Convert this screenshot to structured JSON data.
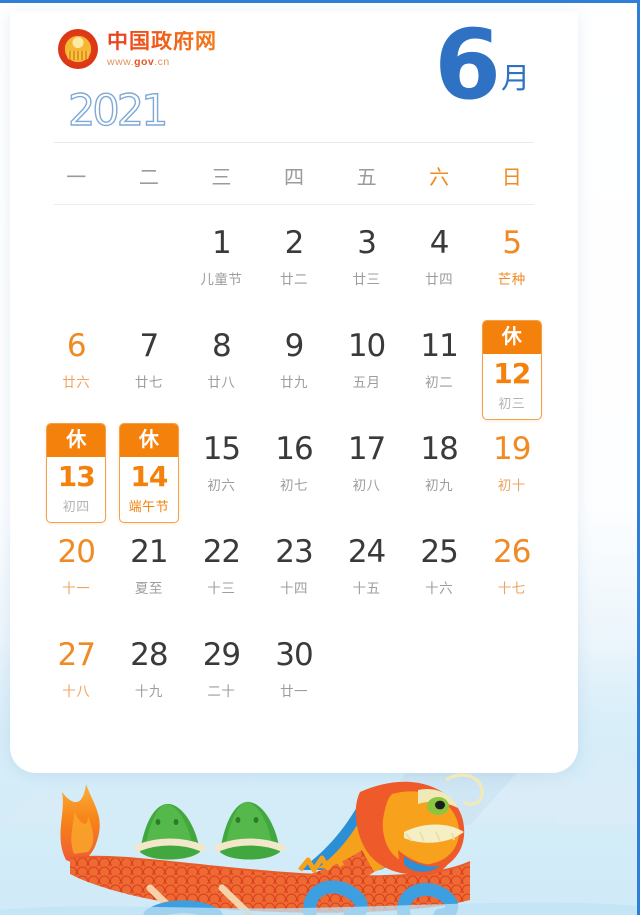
{
  "brand": {
    "name": "中国政府网",
    "url_prefix": "www.",
    "url_main": "gov",
    "url_suffix": ".cn",
    "emblem_icon": "national-emblem-icon"
  },
  "header": {
    "year": "2021",
    "month_number": "6",
    "month_unit": "月"
  },
  "colors": {
    "accent_blue": "#2f72c4",
    "accent_orange": "#f4810c",
    "weekend_orange": "#f08a24",
    "weekday_gray": "#9b9b9b",
    "border_blue": "#2f7ed8"
  },
  "weekdays": [
    {
      "label": "一",
      "weekend": false
    },
    {
      "label": "二",
      "weekend": false
    },
    {
      "label": "三",
      "weekend": false
    },
    {
      "label": "四",
      "weekend": false
    },
    {
      "label": "五",
      "weekend": false
    },
    {
      "label": "六",
      "weekend": true
    },
    {
      "label": "日",
      "weekend": true
    }
  ],
  "rest_label": "休",
  "days": [
    {
      "blank": true
    },
    {
      "blank": true
    },
    {
      "num": "1",
      "sub": "儿童节",
      "type": "normal"
    },
    {
      "num": "2",
      "sub": "廿二",
      "type": "normal"
    },
    {
      "num": "3",
      "sub": "廿三",
      "type": "normal"
    },
    {
      "num": "4",
      "sub": "廿四",
      "type": "normal"
    },
    {
      "num": "5",
      "sub": "芒种",
      "type": "term"
    },
    {
      "num": "6",
      "sub": "廿六",
      "type": "weekend"
    },
    {
      "num": "7",
      "sub": "廿七",
      "type": "normal"
    },
    {
      "num": "8",
      "sub": "廿八",
      "type": "normal"
    },
    {
      "num": "9",
      "sub": "廿九",
      "type": "normal"
    },
    {
      "num": "10",
      "sub": "五月",
      "type": "normal"
    },
    {
      "num": "11",
      "sub": "初二",
      "type": "normal"
    },
    {
      "num": "12",
      "sub": "初三",
      "type": "rest"
    },
    {
      "num": "13",
      "sub": "初四",
      "type": "rest"
    },
    {
      "num": "14",
      "sub": "端午节",
      "type": "rest",
      "festival": true
    },
    {
      "num": "15",
      "sub": "初六",
      "type": "normal"
    },
    {
      "num": "16",
      "sub": "初七",
      "type": "normal"
    },
    {
      "num": "17",
      "sub": "初八",
      "type": "normal"
    },
    {
      "num": "18",
      "sub": "初九",
      "type": "normal"
    },
    {
      "num": "19",
      "sub": "初十",
      "type": "weekend"
    },
    {
      "num": "20",
      "sub": "十一",
      "type": "weekend"
    },
    {
      "num": "21",
      "sub": "夏至",
      "type": "normal"
    },
    {
      "num": "22",
      "sub": "十三",
      "type": "normal"
    },
    {
      "num": "23",
      "sub": "十四",
      "type": "normal"
    },
    {
      "num": "24",
      "sub": "十五",
      "type": "normal"
    },
    {
      "num": "25",
      "sub": "十六",
      "type": "normal"
    },
    {
      "num": "26",
      "sub": "十七",
      "type": "weekend"
    },
    {
      "num": "27",
      "sub": "十八",
      "type": "weekend"
    },
    {
      "num": "28",
      "sub": "十九",
      "type": "normal"
    },
    {
      "num": "29",
      "sub": "二十",
      "type": "normal"
    },
    {
      "num": "30",
      "sub": "廿一",
      "type": "normal"
    },
    {
      "blank": true
    },
    {
      "blank": true
    },
    {
      "blank": true
    },
    {
      "blank": true
    }
  ],
  "illustration": {
    "name": "dragon-boat-illustration",
    "elements": [
      "dragon-head",
      "dragon-boat",
      "zongzi-character",
      "zongzi-character",
      "flame-tail",
      "water-waves",
      "mountains"
    ]
  }
}
